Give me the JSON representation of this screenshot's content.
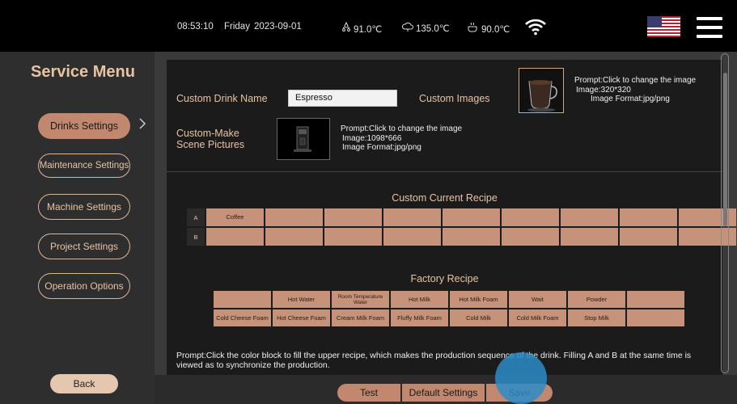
{
  "status": {
    "time": "08:53:10",
    "day": "Friday",
    "date": "2023-09-01",
    "temp1": "91.0℃",
    "temp2": "135.0℃",
    "temp3": "90.0℃"
  },
  "sidebar": {
    "title": "Service Menu",
    "items": [
      {
        "label": "Drinks Settings"
      },
      {
        "label": "Maintenance Settings"
      },
      {
        "label": "Machine Settings"
      },
      {
        "label": "Project Settings"
      },
      {
        "label": "Operation Options"
      }
    ],
    "back_label": "Back"
  },
  "main": {
    "custom_name_label": "Custom Drink Name",
    "custom_name_value": "Espresso",
    "custom_images_label": "Custom Images",
    "custom_images_prompt": [
      "Prompt:Click to change the image",
      "Image:320*320",
      "Image Format:jpg/png"
    ],
    "scene_label": [
      "Custom-Make",
      "Scene Pictures"
    ],
    "scene_prompt": [
      "Prompt:Click to change the image",
      "Image:1098*666",
      "Image Format:jpg/png"
    ],
    "current_recipe_title": "Custom Current Recipe",
    "current_recipe_rows": [
      {
        "label": "A",
        "cells": [
          "Coffee",
          "",
          "",
          "",
          "",
          "",
          "",
          "",
          ""
        ]
      },
      {
        "label": "B",
        "cells": [
          "",
          "",
          "",
          "",
          "",
          "",
          "",
          "",
          ""
        ]
      }
    ],
    "factory_title": "Factory Recipe",
    "factory_rows": [
      [
        "",
        "Hot Water",
        "Room Temperature Water",
        "Hot Milk",
        "Hot Milk Foam",
        "Wait",
        "Powder",
        ""
      ],
      [
        "Cold Cheese Foam",
        "Hot Cheese Foam",
        "Cream Milk Foam",
        "Fluffy Milk Foam",
        "Cold Milk",
        "Cold Milk Foam",
        "Stop Milk",
        ""
      ]
    ],
    "bottom_prompt": "Prompt:Click the color block to fill the upper recipe, which makes the production sequence of the drink. Filling A and B at the same time is viewed as to synchronize the production."
  },
  "bottombar": {
    "test_label": "Test",
    "default_label": "Default Settings",
    "save_label": "Save"
  },
  "colors": {
    "accent": "#c2876f",
    "cell": "#c7927a",
    "text": "#e8c3a4",
    "ripple": "#2c8cc8"
  }
}
